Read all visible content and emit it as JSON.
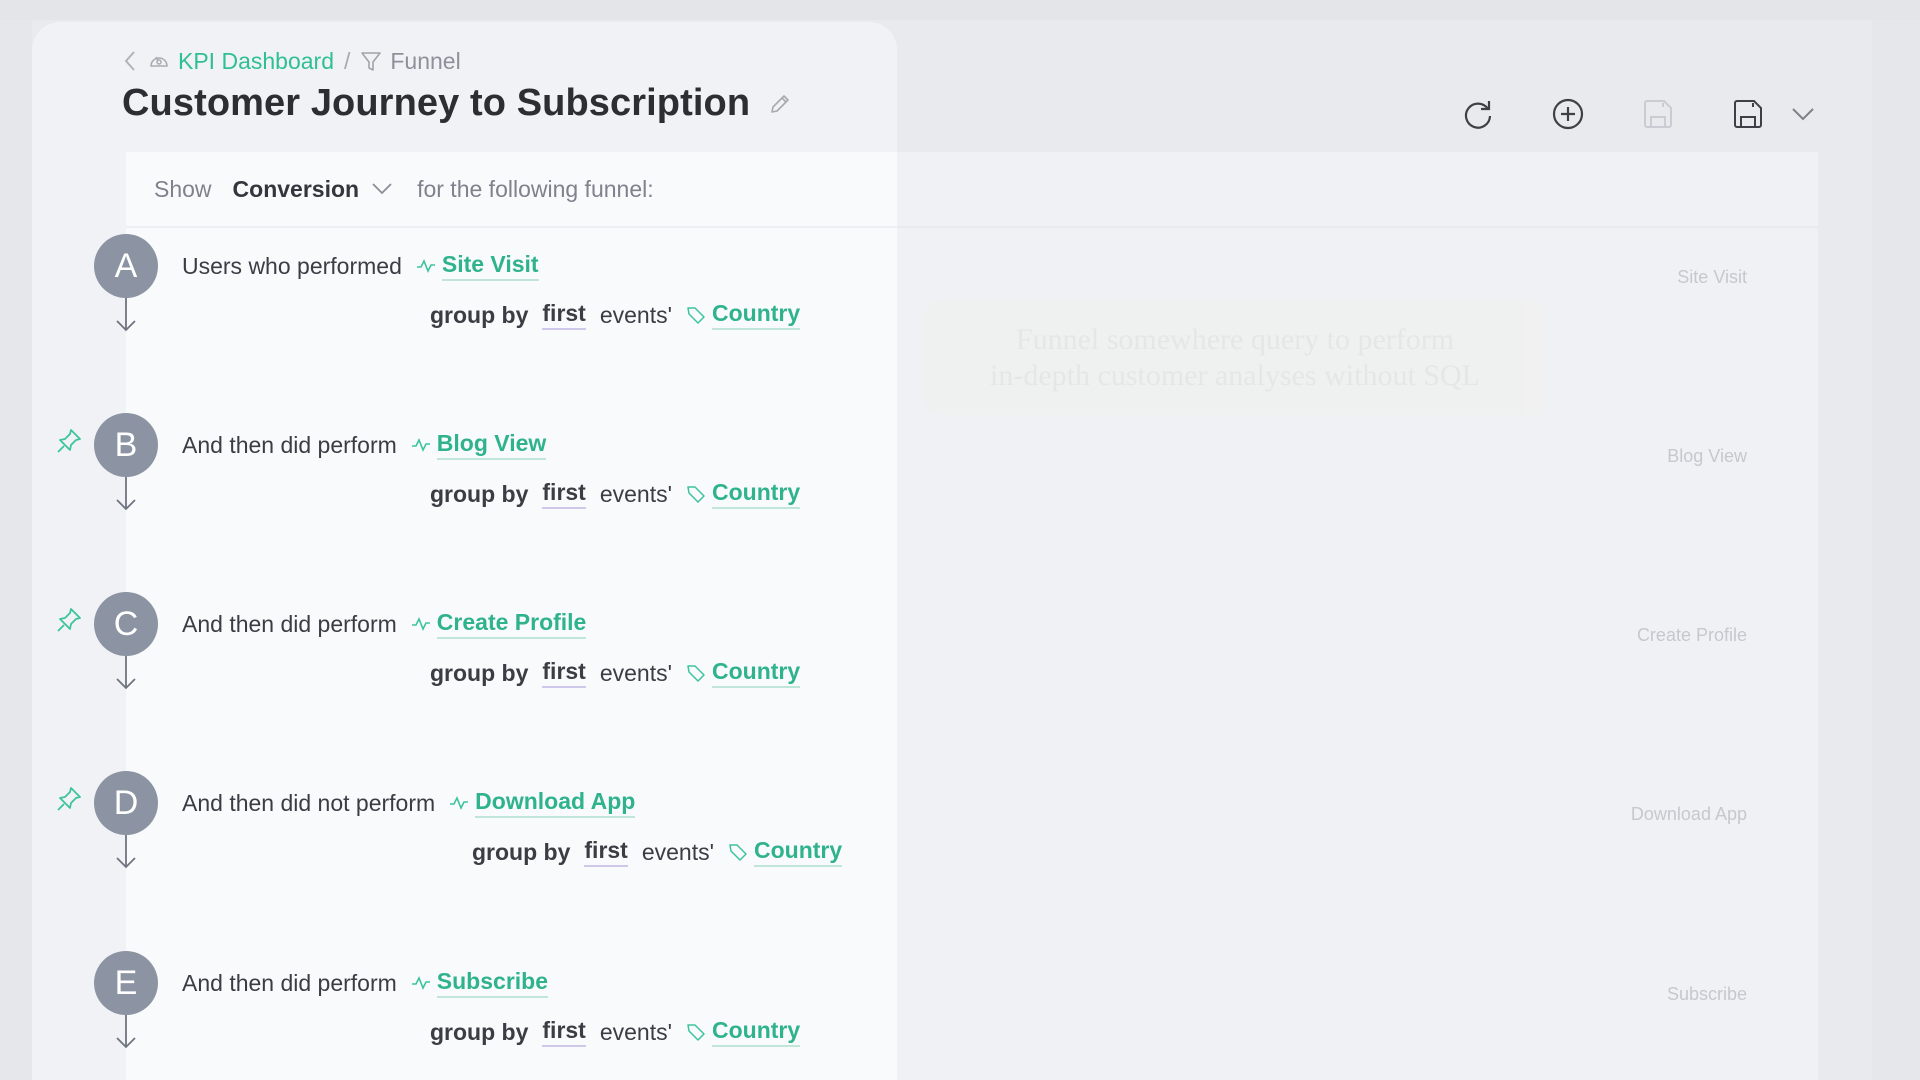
{
  "breadcrumb": {
    "back_icon": "chevron-left-icon",
    "dashboard_icon": "gauge-icon",
    "dashboard_label": "KPI Dashboard",
    "separator": "/",
    "current_icon": "funnel-icon",
    "current_label": "Funnel"
  },
  "header": {
    "title": "Customer Journey to Subscription",
    "edit_icon": "pencil-icon"
  },
  "toolbar": {
    "buttons": [
      {
        "name": "refresh",
        "icon": "refresh-icon",
        "enabled": true
      },
      {
        "name": "add",
        "icon": "plus-circle-icon",
        "enabled": true
      },
      {
        "name": "save-disabled",
        "icon": "save-icon",
        "enabled": false
      },
      {
        "name": "save",
        "icon": "save-icon",
        "enabled": true
      },
      {
        "name": "more",
        "icon": "chevron-down-icon",
        "enabled": true
      }
    ]
  },
  "query": {
    "show_label": "Show",
    "metric": "Conversion",
    "suffix": "for the following funnel:"
  },
  "steps": [
    {
      "letter": "A",
      "prefix": "Users who performed",
      "event": "Site Visit",
      "group_by": "group by",
      "agg": "first",
      "events_word": "events'",
      "property": "Country",
      "pinned": false,
      "right_label": "Site Visit"
    },
    {
      "letter": "B",
      "prefix": "And then did perform",
      "event": "Blog View",
      "group_by": "group by",
      "agg": "first",
      "events_word": "events'",
      "property": "Country",
      "pinned": true,
      "right_label": "Blog View"
    },
    {
      "letter": "C",
      "prefix": "And then did perform",
      "event": "Create Profile",
      "group_by": "group by",
      "agg": "first",
      "events_word": "events'",
      "property": "Country",
      "pinned": true,
      "right_label": "Create Profile"
    },
    {
      "letter": "D",
      "prefix": "And then did not perform",
      "event": "Download App",
      "group_by": "group by",
      "agg": "first",
      "events_word": "events'",
      "property": "Country",
      "pinned": true,
      "right_label": "Download App"
    },
    {
      "letter": "E",
      "prefix": "And then did perform",
      "event": "Subscribe",
      "group_by": "group by",
      "agg": "first",
      "events_word": "events'",
      "property": "Country",
      "pinned": false,
      "right_label": "Subscribe"
    }
  ],
  "ghost_tooltip": {
    "line1": "Funnel somewhere query to perform",
    "line2": "in-depth customer analyses without SQL"
  },
  "colors": {
    "accent": "#2fbf95",
    "step_circle": "#8c94a3",
    "agg_underline": "#cfc8ea"
  }
}
